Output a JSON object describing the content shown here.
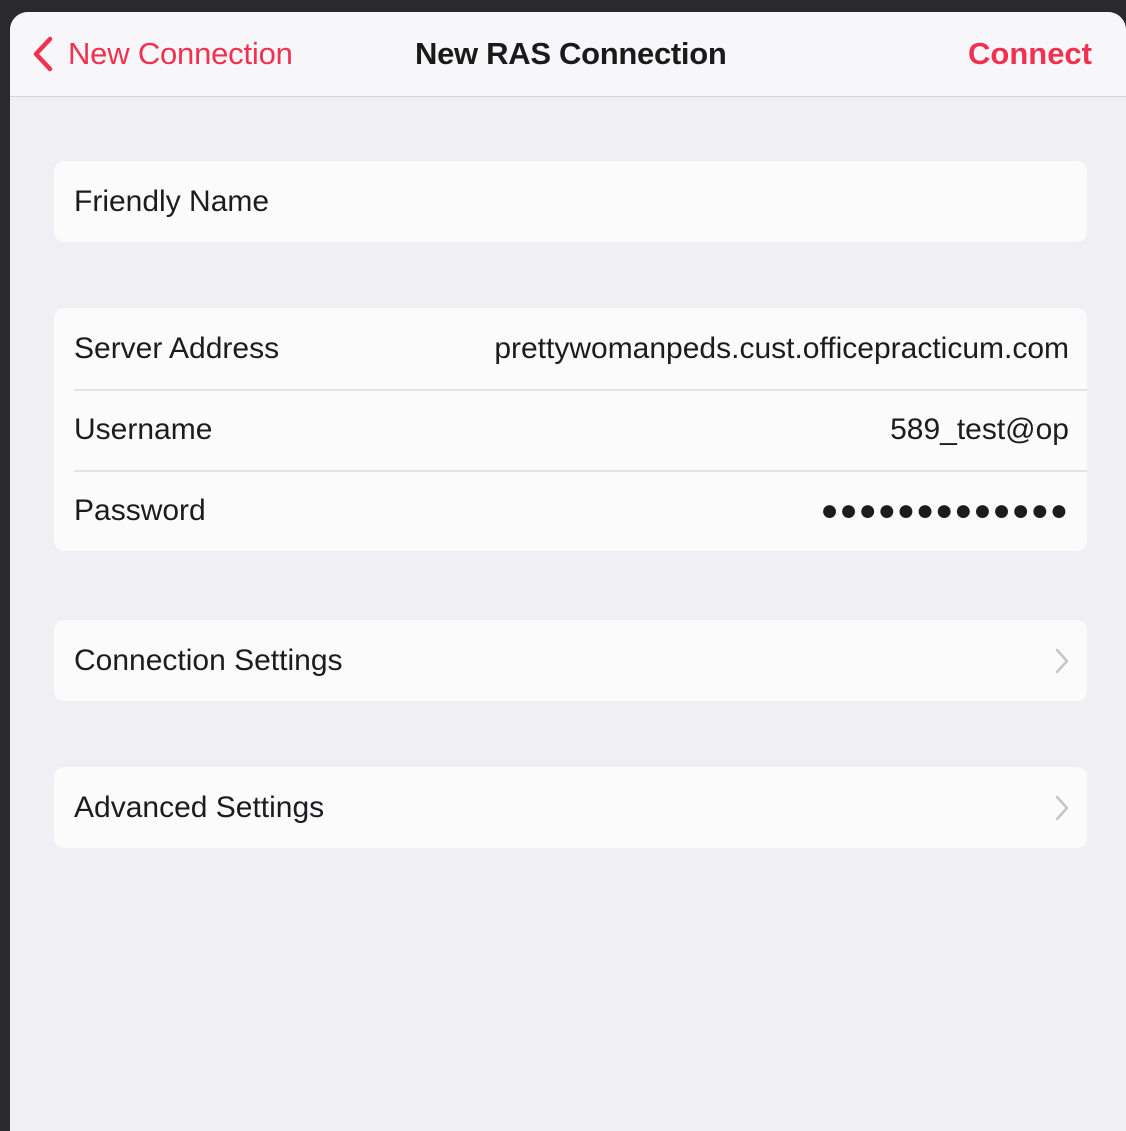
{
  "navbar": {
    "back_label": "New Connection",
    "title": "New RAS Connection",
    "action_label": "Connect"
  },
  "form": {
    "friendly_name": {
      "label": "Friendly Name",
      "value": ""
    },
    "server": {
      "server_address_label": "Server Address",
      "server_address_value": "prettywomanpeds.cust.officepracticum.com",
      "username_label": "Username",
      "username_value": "589_test@op",
      "password_label": "Password",
      "password_value": "●●●●●●●●●●●●●"
    },
    "connection_settings_label": "Connection Settings",
    "advanced_settings_label": "Advanced Settings"
  },
  "colors": {
    "accent": "#f0314f",
    "background": "#efeff4",
    "cell": "#fbfbfc"
  },
  "icons": {
    "back": "chevron-left-icon",
    "disclosure": "chevron-right-icon"
  }
}
